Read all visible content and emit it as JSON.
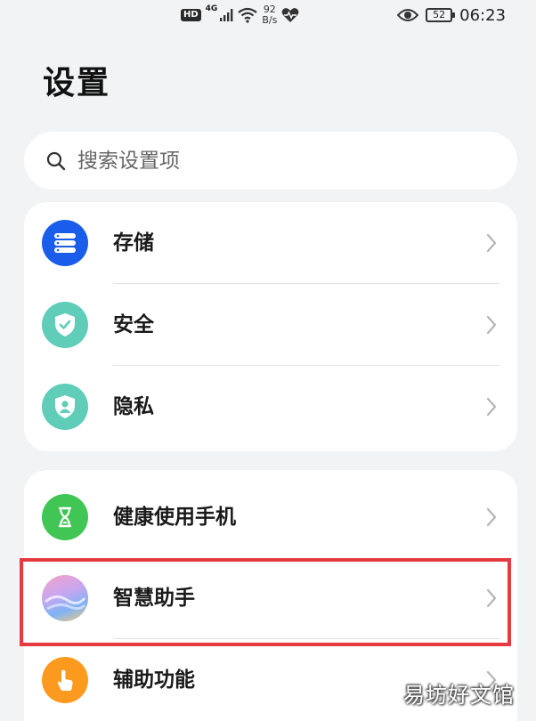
{
  "status_bar": {
    "hd": "HD",
    "network": "4G",
    "speed_value": "92",
    "speed_unit": "B/s",
    "battery": "52",
    "time": "06:23",
    "icons": [
      "hd-icon",
      "signal-icon",
      "wifi-icon",
      "health-heart-icon",
      "eye-comfort-icon",
      "battery-icon"
    ]
  },
  "page": {
    "title": "设置"
  },
  "search": {
    "placeholder": "搜索设置项",
    "value": ""
  },
  "groups": [
    {
      "items": [
        {
          "label": "存储",
          "icon": "storage-icon",
          "color": "#1a5dea"
        },
        {
          "label": "安全",
          "icon": "security-shield-icon",
          "color": "#5fcdb8"
        },
        {
          "label": "隐私",
          "icon": "privacy-shield-icon",
          "color": "#5fcdb8"
        }
      ]
    },
    {
      "items": [
        {
          "label": "健康使用手机",
          "icon": "hourglass-icon",
          "color": "#41c655"
        },
        {
          "label": "智慧助手",
          "icon": "smart-assistant-icon",
          "color": "#c9a6f0",
          "highlighted": true
        },
        {
          "label": "辅助功能",
          "icon": "hand-pointer-icon",
          "color": "#fb9a1e"
        }
      ]
    }
  ],
  "highlight_color": "#e63a3f",
  "watermark": "易坊好文馆"
}
